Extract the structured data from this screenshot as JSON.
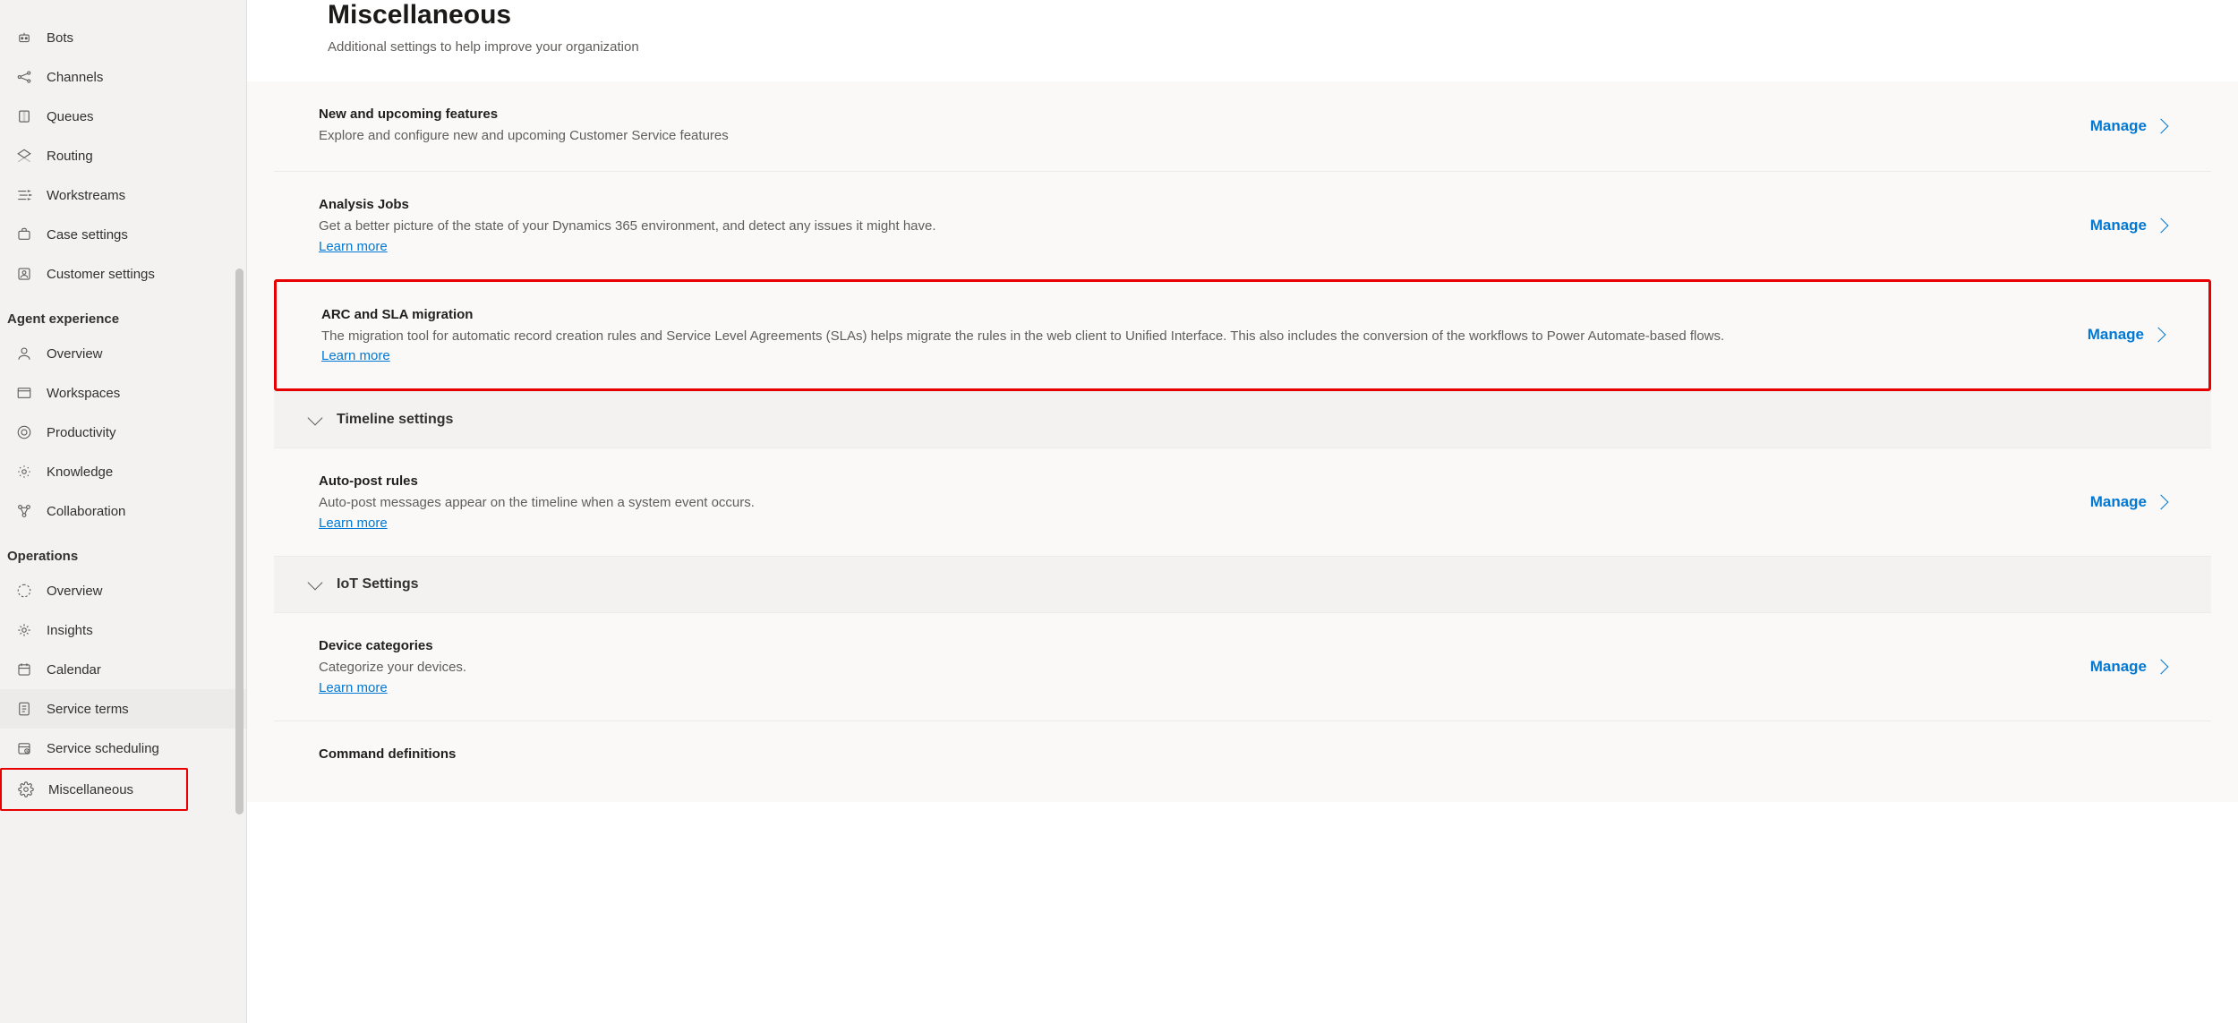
{
  "sidebar": {
    "top_items": [
      {
        "label": "Bots",
        "id": "bots"
      },
      {
        "label": "Channels",
        "id": "channels"
      },
      {
        "label": "Queues",
        "id": "queues"
      },
      {
        "label": "Routing",
        "id": "routing"
      },
      {
        "label": "Workstreams",
        "id": "workstreams"
      },
      {
        "label": "Case settings",
        "id": "case-settings"
      },
      {
        "label": "Customer settings",
        "id": "customer-settings"
      }
    ],
    "group_agent_header": "Agent experience",
    "agent_items": [
      {
        "label": "Overview",
        "id": "overview"
      },
      {
        "label": "Workspaces",
        "id": "workspaces"
      },
      {
        "label": "Productivity",
        "id": "productivity"
      },
      {
        "label": "Knowledge",
        "id": "knowledge"
      },
      {
        "label": "Collaboration",
        "id": "collaboration"
      }
    ],
    "group_ops_header": "Operations",
    "ops_items": [
      {
        "label": "Overview",
        "id": "ops-overview"
      },
      {
        "label": "Insights",
        "id": "insights"
      },
      {
        "label": "Calendar",
        "id": "calendar"
      },
      {
        "label": "Service terms",
        "id": "service-terms"
      },
      {
        "label": "Service scheduling",
        "id": "service-scheduling"
      },
      {
        "label": "Miscellaneous",
        "id": "miscellaneous"
      }
    ]
  },
  "page": {
    "title": "Miscellaneous",
    "subtitle": "Additional settings to help improve your organization"
  },
  "action_label": "Manage",
  "learn_more_label": "Learn more",
  "cards": {
    "new_features": {
      "title": "New and upcoming features",
      "desc": "Explore and configure new and upcoming Customer Service features"
    },
    "analysis": {
      "title": "Analysis Jobs",
      "desc": "Get a better picture of the state of your Dynamics 365 environment, and detect any issues it might have."
    },
    "arc_sla": {
      "title": "ARC and SLA migration",
      "desc": "The migration tool for automatic record creation rules and Service Level Agreements (SLAs) helps migrate the rules in the web client to Unified Interface. This also includes the conversion of the workflows to Power Automate-based flows."
    },
    "timeline_header": "Timeline settings",
    "autopost": {
      "title": "Auto-post rules",
      "desc": "Auto-post messages appear on the timeline when a system event occurs."
    },
    "iot_header": "IoT Settings",
    "device_cat": {
      "title": "Device categories",
      "desc": "Categorize your devices."
    },
    "command_def": {
      "title": "Command definitions"
    }
  }
}
